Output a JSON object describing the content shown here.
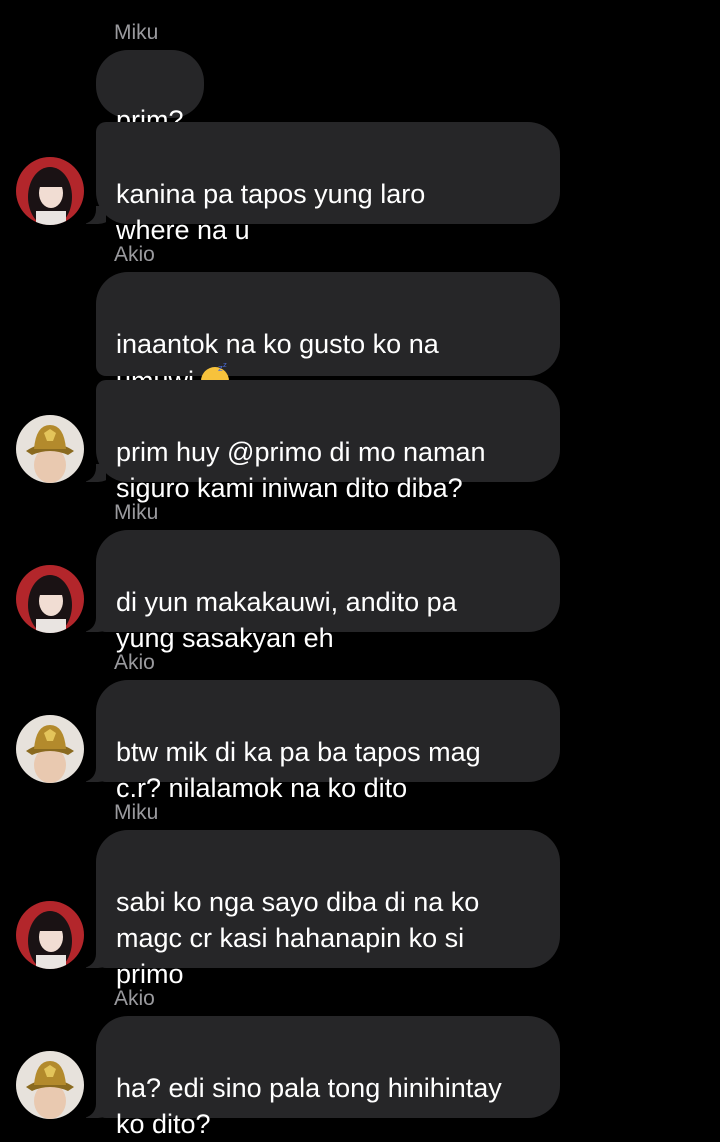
{
  "thread": {
    "senders": {
      "miku": "Miku",
      "akio": "Akio"
    },
    "messages": [
      {
        "sender": "Miku",
        "text": "prim?"
      },
      {
        "sender": "Miku",
        "text": "kanina pa tapos yung laro\nwhere na u"
      },
      {
        "sender": "Akio",
        "text": "inaantok na ko gusto ko na\numuwi",
        "emoji": "sleeping-face"
      },
      {
        "sender": "Akio",
        "text": "prim huy @primo di mo naman\nsiguro kami iniwan dito diba?"
      },
      {
        "sender": "Miku",
        "text": "di yun makakauwi, andito pa\nyung sasakyan eh"
      },
      {
        "sender": "Akio",
        "text": "btw mik di ka pa ba tapos mag\nc.r? nilalamok na ko dito"
      },
      {
        "sender": "Miku",
        "text": "sabi ko nga sayo diba di na ko\nmagc cr kasi hahanapin ko si\nprimo"
      },
      {
        "sender": "Akio",
        "text": "ha? edi sino pala tong hinihintay\nko dito?"
      }
    ]
  },
  "colors": {
    "background": "#000000",
    "bubble": "#262628",
    "text": "#ffffff",
    "sender": "#9a9a9e"
  },
  "icons": {
    "miku_avatar": "girl-portrait-avatar",
    "akio_avatar": "bucket-hat-avatar",
    "emoji": "sleeping-face"
  }
}
